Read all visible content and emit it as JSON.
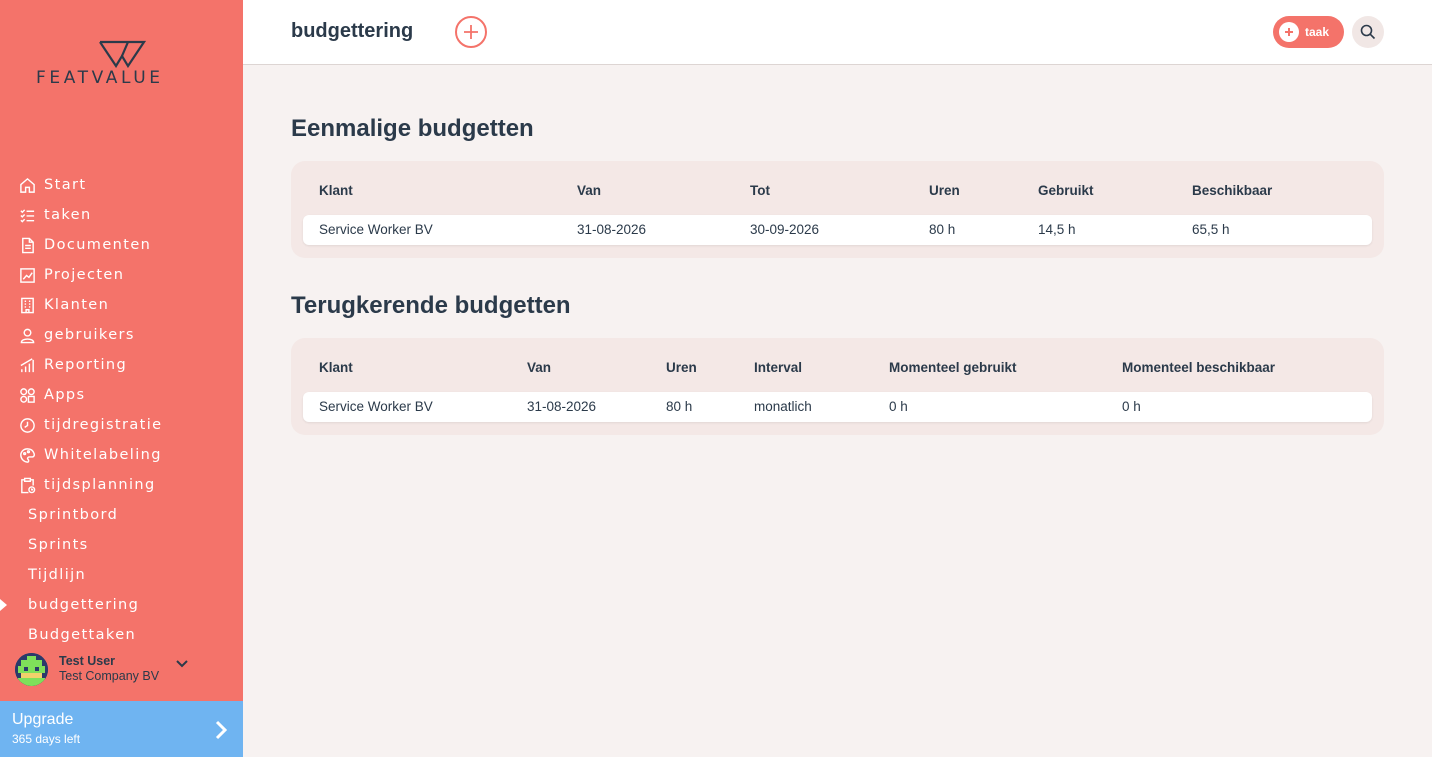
{
  "brand": {
    "name": "FEATVALUE"
  },
  "sidebar": {
    "items": [
      {
        "label": "Start",
        "icon": "home-icon"
      },
      {
        "label": "taken",
        "icon": "checklist-icon"
      },
      {
        "label": "Documenten",
        "icon": "document-icon"
      },
      {
        "label": "Projecten",
        "icon": "chart-board-icon"
      },
      {
        "label": "Klanten",
        "icon": "building-icon"
      },
      {
        "label": "gebruikers",
        "icon": "user-icon"
      },
      {
        "label": "Reporting",
        "icon": "bar-chart-icon"
      },
      {
        "label": "Apps",
        "icon": "apps-icon"
      },
      {
        "label": "tijdregistratie",
        "icon": "timer-icon"
      },
      {
        "label": "Whitelabeling",
        "icon": "palette-icon"
      },
      {
        "label": "tijdsplanning",
        "icon": "clipboard-clock-icon"
      }
    ],
    "subitems": [
      {
        "label": "Sprintbord"
      },
      {
        "label": "Sprints"
      },
      {
        "label": "Tijdlijn"
      },
      {
        "label": "budgettering",
        "active": true
      },
      {
        "label": "Budgettaken"
      }
    ]
  },
  "user": {
    "name": "Test User",
    "company": "Test Company BV"
  },
  "upgrade": {
    "title": "Upgrade",
    "subtitle": "365 days left"
  },
  "header": {
    "title": "budgettering",
    "task_label": "taak"
  },
  "colors": {
    "accent": "#f4736a",
    "upgrade": "#6fb4f1",
    "text": "#2b3a4a",
    "background": "#f7f2f1"
  },
  "one_time": {
    "title": "Eenmalige budgetten",
    "columns": [
      "Klant",
      "Van",
      "Tot",
      "Uren",
      "Gebruikt",
      "Beschikbaar"
    ],
    "rows": [
      [
        "Service Worker BV",
        "31-08-2026",
        "30-09-2026",
        "80 h",
        "14,5 h",
        "65,5 h"
      ]
    ]
  },
  "recurring": {
    "title": "Terugkerende budgetten",
    "columns": [
      "Klant",
      "Van",
      "Uren",
      "Interval",
      "Momenteel gebruikt",
      "Momenteel beschikbaar"
    ],
    "rows": [
      [
        "Service Worker BV",
        "31-08-2026",
        "80 h",
        "monatlich",
        "0 h",
        "0 h"
      ]
    ]
  }
}
